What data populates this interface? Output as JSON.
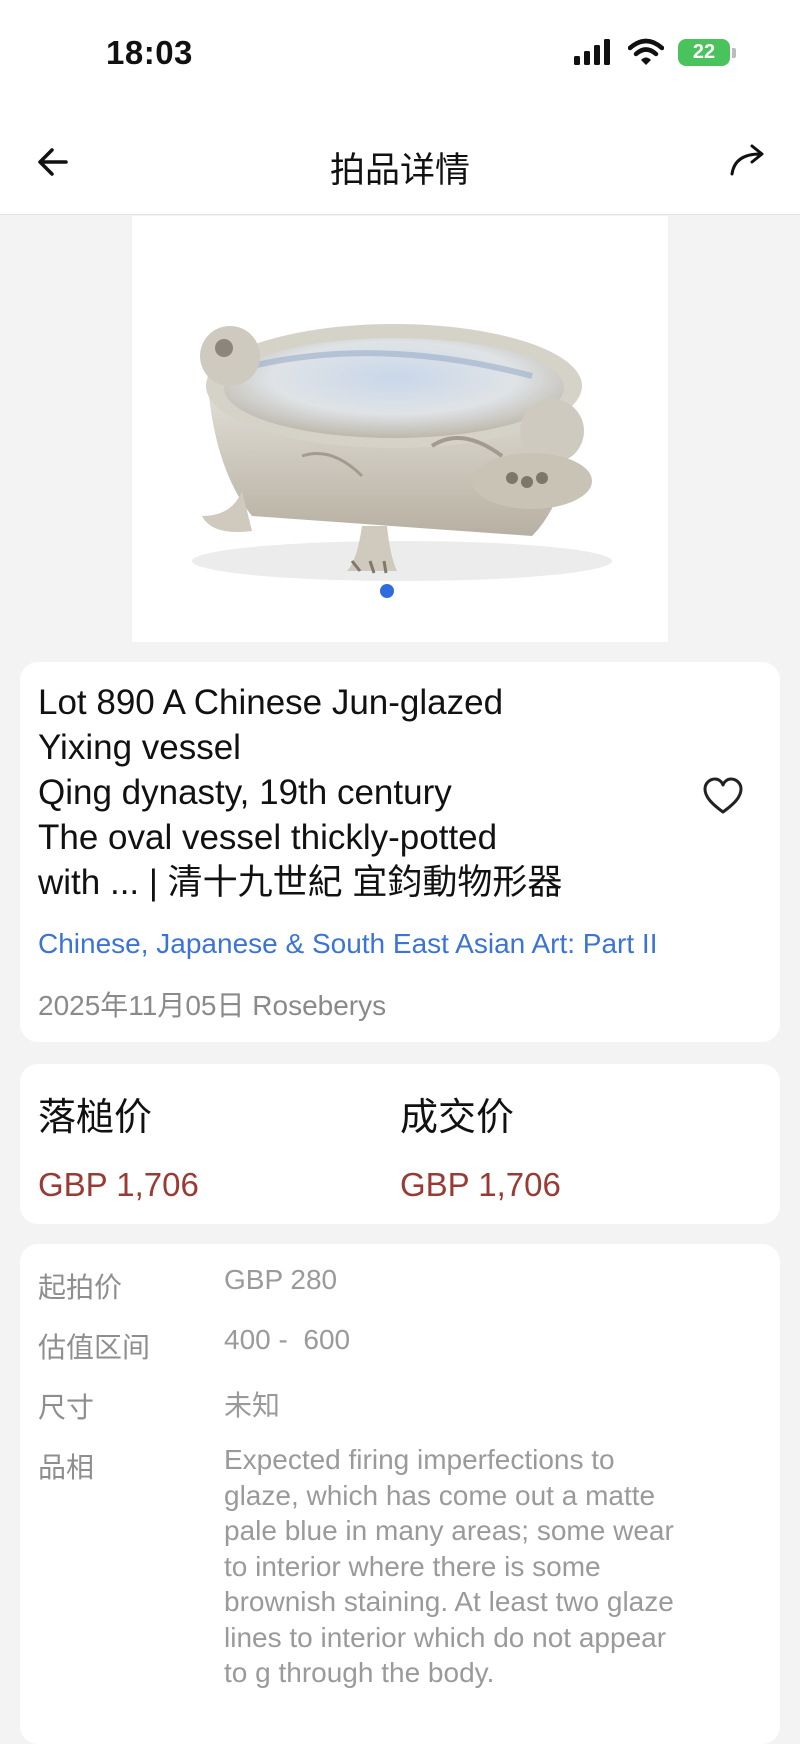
{
  "status_bar": {
    "time": "18:03",
    "battery": "22"
  },
  "header": {
    "title": "拍品详情"
  },
  "lot": {
    "title_lines": [
      "Lot 890 A Chinese Jun-glazed",
      "Yixing vessel",
      "Qing dynasty, 19th century",
      "The oval vessel thickly-potted",
      "with ... | 清十九世紀 宜鈞動物形器"
    ],
    "sale_name": "Chinese, Japanese & South East Asian Art: Part II",
    "date_house": "2025年11月05日 Roseberys"
  },
  "prices": {
    "hammer_label": "落槌价",
    "hammer_value": "GBP 1,706",
    "deal_label": "成交价",
    "deal_value": "GBP 1,706"
  },
  "details": {
    "start_label": "起拍价",
    "start_value": "GBP 280",
    "estimate_label": "估值区间",
    "estimate_value": "400 -  600",
    "size_label": "尺寸",
    "size_value": "未知",
    "condition_label": "品相",
    "condition_lines": [
      "Expected firing imperfections to",
      "glaze, which has come out a matte",
      "pale blue in many areas; some wear",
      "to interior where there is some",
      "brownish staining. At least two glaze",
      "lines to interior which do not appear",
      "to g through the body."
    ]
  },
  "colors": {
    "accent_link": "#3c74d6",
    "price": "#9a3a34",
    "dot": "#2e6bdc"
  }
}
